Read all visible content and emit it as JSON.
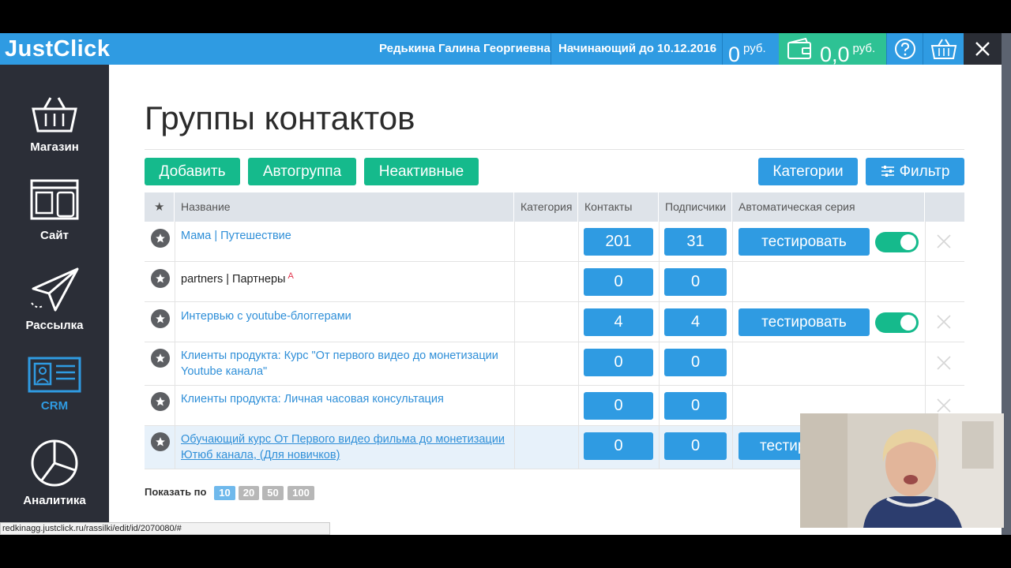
{
  "app": {
    "logo": "JustClick"
  },
  "header": {
    "user_name": "Редькина Галина Георгиевна",
    "plan": "Начинающий до 10.12.2016",
    "balance_value": "0",
    "balance_currency": "руб.",
    "wallet_value": "0,0",
    "wallet_currency": "руб."
  },
  "sidebar": {
    "items": [
      {
        "label": "Магазин",
        "icon": "basket-icon"
      },
      {
        "label": "Сайт",
        "icon": "site-layout-icon"
      },
      {
        "label": "Рассылка",
        "icon": "paper-plane-icon"
      },
      {
        "label": "CRM",
        "icon": "contact-card-icon",
        "active": true
      },
      {
        "label": "Аналитика",
        "icon": "pie-chart-icon"
      }
    ]
  },
  "page": {
    "title": "Группы контактов",
    "buttons": {
      "add": "Добавить",
      "autogroup": "Автогруппа",
      "inactive": "Неактивные",
      "categories": "Категории",
      "filter": "Фильтр"
    }
  },
  "table": {
    "headers": {
      "star": "★",
      "name": "Название",
      "category": "Категория",
      "contacts": "Контакты",
      "subscribers": "Подписчики",
      "auto_series": "Автоматическая серия"
    },
    "rows": [
      {
        "name": "Мама | Путешествие",
        "contacts": "201",
        "subscribers": "31",
        "series_button": "тестировать"
      },
      {
        "name": "partners | Партнеры",
        "badge": "A",
        "contacts": "0",
        "subscribers": "0"
      },
      {
        "name": "Интервью с youtube-блоггерами",
        "contacts": "4",
        "subscribers": "4",
        "series_button": "тестировать"
      },
      {
        "name": "Клиенты продукта: Курс \"От первого видео до монетизации Youtube канала\"",
        "contacts": "0",
        "subscribers": "0"
      },
      {
        "name": "Клиенты продукта: Личная часовая консультация",
        "contacts": "0",
        "subscribers": "0"
      },
      {
        "name": "Обучающий курс От Первого видео фильма до монетизации Ютюб канала, (Для новичков)",
        "contacts": "0",
        "subscribers": "0",
        "series_button": "тестир"
      }
    ]
  },
  "pagination": {
    "label": "Показать по",
    "options": [
      "10",
      "20",
      "50",
      "100"
    ],
    "selected": "10"
  },
  "status_bar": {
    "url": "redkinagg.justclick.ru/rassilki/edit/id/2070080/#"
  },
  "colors": {
    "primary": "#2f9be2",
    "green": "#15ba8c",
    "sidebar": "#2b2e37"
  }
}
